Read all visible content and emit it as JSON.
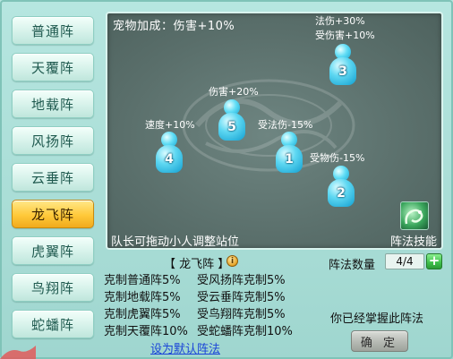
{
  "formations": [
    {
      "label": "普通阵",
      "active": false
    },
    {
      "label": "天覆阵",
      "active": false
    },
    {
      "label": "地载阵",
      "active": false
    },
    {
      "label": "风扬阵",
      "active": false
    },
    {
      "label": "云垂阵",
      "active": false
    },
    {
      "label": "龙飞阵",
      "active": true
    },
    {
      "label": "虎翼阵",
      "active": false
    },
    {
      "label": "鸟翔阵",
      "active": false
    },
    {
      "label": "蛇蟠阵",
      "active": false
    }
  ],
  "field": {
    "pet_bonus": "宠物加成：伤害+10%",
    "hint": "队长可拖动小人调整站位",
    "skill_label": "阵法技能",
    "skill_icon": "dragon-skill-icon",
    "positions": [
      {
        "number": "1",
        "effects": [
          "受法伤-15%"
        ]
      },
      {
        "number": "2",
        "effects": [
          "受物伤-15%"
        ]
      },
      {
        "number": "3",
        "effects": [
          "法伤+30%",
          "受伤害+10%"
        ]
      },
      {
        "number": "4",
        "effects": [
          "速度+10%"
        ]
      },
      {
        "number": "5",
        "effects": [
          "伤害+20%"
        ]
      }
    ]
  },
  "detail": {
    "title": "【 龙飞阵 】",
    "counter_label": "阵法数量",
    "counter_value": "4/4",
    "plus": "+",
    "effects": [
      [
        "克制普通阵5%",
        "受风扬阵克制5%"
      ],
      [
        "克制地载阵5%",
        "受云垂阵克制5%"
      ],
      [
        "克制虎翼阵5%",
        "受鸟翔阵克制5%"
      ],
      [
        "克制天覆阵10%",
        "受蛇蟠阵克制10%"
      ]
    ],
    "default_link": "设为默认阵法",
    "mastered_text": "你已经掌握此阵法",
    "confirm": "确 定"
  },
  "colors": {
    "active_button": "#ffc93a",
    "field_bg": "#5a6f6b",
    "member": "#5fd8f2",
    "link": "#1a44d8"
  }
}
